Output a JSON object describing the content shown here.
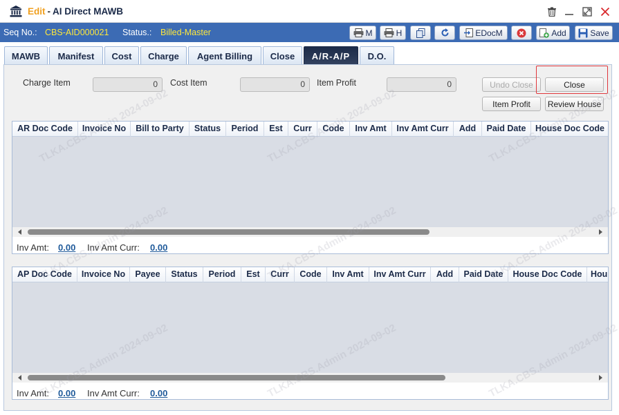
{
  "window": {
    "mode": "Edit",
    "separator": "-",
    "title": "AI Direct MAWB"
  },
  "toolbar": {
    "seq_label": "Seq No.:",
    "seq_value": "CBS-AID000021",
    "status_label": "Status.:",
    "status_value": "Billed-Master",
    "buttons": {
      "print_m": "M",
      "print_h": "H",
      "edocm": "EDocM",
      "add": "Add",
      "save": "Save"
    }
  },
  "tabs": [
    "MAWB",
    "Manifest",
    "Cost",
    "Charge",
    "Agent Billing",
    "Close",
    "A/R-A/P",
    "D.O."
  ],
  "active_tab": "A/R-A/P",
  "summary": {
    "charge_item_label": "Charge Item",
    "charge_item_value": "0",
    "cost_item_label": "Cost Item",
    "cost_item_value": "0",
    "item_profit_label": "Item Profit",
    "item_profit_value": "0"
  },
  "actions": {
    "undo_close": "Undo Close",
    "close": "Close",
    "item_profit": "Item Profit",
    "review_house": "Review House"
  },
  "ar_grid": {
    "columns": [
      "AR Doc Code",
      "Invoice No",
      "Bill to Party",
      "Status",
      "Period",
      "Est",
      "Curr",
      "Code",
      "Inv Amt",
      "Inv Amt Curr",
      "Add",
      "Paid Date",
      "House Doc Code"
    ],
    "rows": [],
    "footer": {
      "inv_amt_label": "Inv Amt:",
      "inv_amt_value": "0.00",
      "inv_amt_curr_label": "Inv Amt Curr:",
      "inv_amt_curr_value": "0.00"
    }
  },
  "ap_grid": {
    "columns": [
      "AP Doc Code",
      "Invoice No",
      "Payee",
      "Status",
      "Period",
      "Est",
      "Curr",
      "Code",
      "Inv Amt",
      "Inv Amt Curr",
      "Add",
      "Paid Date",
      "House Doc Code",
      "Hou"
    ],
    "rows": [],
    "footer": {
      "inv_amt_label": "Inv Amt:",
      "inv_amt_value": "0.00",
      "inv_amt_curr_label": "Inv Amt Curr:",
      "inv_amt_curr_value": "0.00"
    }
  },
  "watermark": "TLKA.CBS.Admin 2024-09-02",
  "colors": {
    "toolbar_bg": "#3c6bb4",
    "status_value": "#ffe83a",
    "mode_text": "#f0a020",
    "active_tab_bg": "#1c2b48",
    "highlight": "#e0363b",
    "link": "#1f5a9a"
  }
}
